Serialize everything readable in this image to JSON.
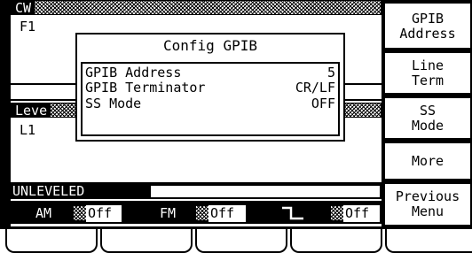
{
  "display": {
    "cw_section": {
      "label": "CW",
      "freq_label": "F1"
    },
    "level_section": {
      "label": "Leve",
      "level_label": "L1"
    },
    "status": {
      "unleveled": "UNLEVELED"
    },
    "modulation_bar": {
      "am": {
        "label": "AM",
        "state": "Off"
      },
      "fm": {
        "label": "FM",
        "state": "Off"
      },
      "pulse": {
        "icon": "pulse-icon",
        "state": "Off"
      }
    }
  },
  "dialog": {
    "title": "Config GPIB",
    "rows": [
      {
        "label": "GPIB Address",
        "value": "5"
      },
      {
        "label": "GPIB Terminator",
        "value": "CR/LF"
      },
      {
        "label": "SS Mode",
        "value": "OFF"
      }
    ]
  },
  "softkeys": [
    {
      "line1": "GPIB",
      "line2": "Address"
    },
    {
      "line1": "Line",
      "line2": "Term"
    },
    {
      "line1": "SS",
      "line2": "Mode"
    },
    {
      "line1": "More",
      "line2": ""
    },
    {
      "line1": "Previous",
      "line2": "Menu"
    }
  ],
  "bottom_keys": [
    "",
    "",
    "",
    "",
    ""
  ]
}
